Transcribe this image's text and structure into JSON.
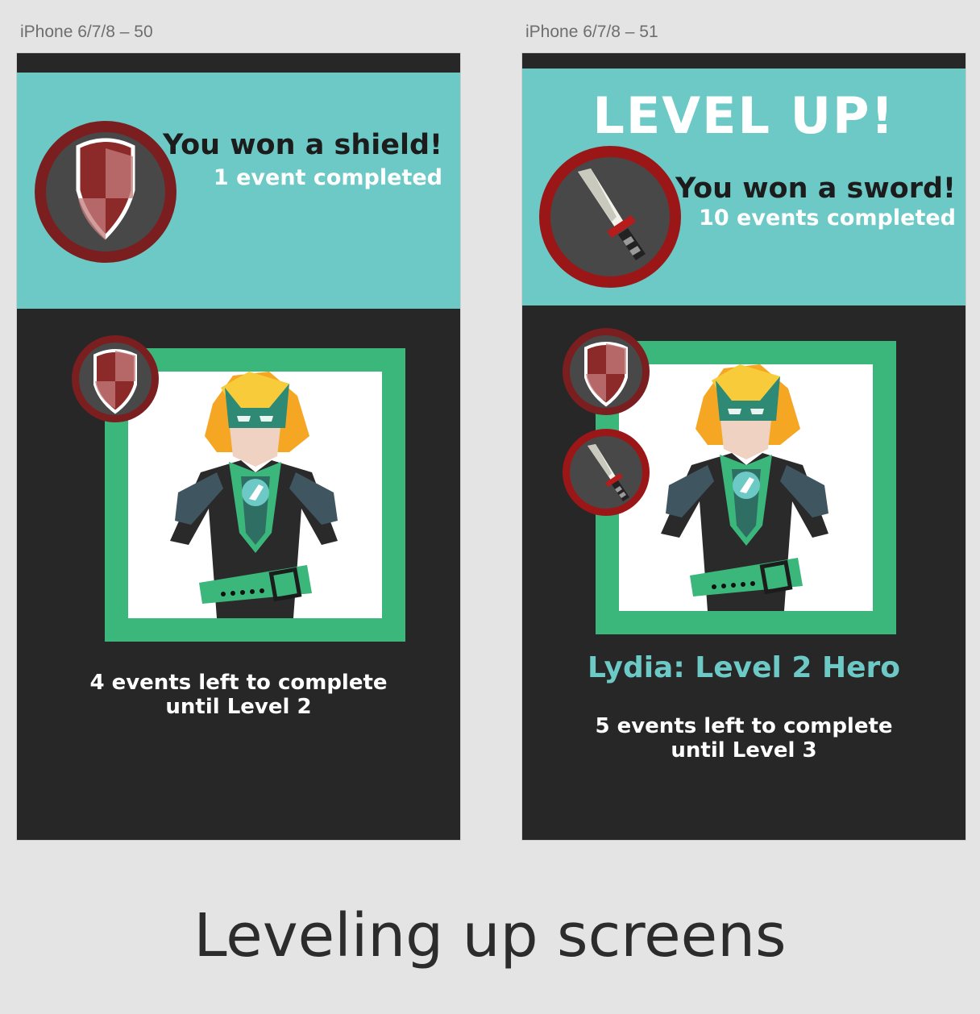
{
  "artboards": [
    {
      "label": "iPhone 6/7/8 – 50",
      "heading": "You won a shield!",
      "subheading": "1 event completed",
      "progress_line1": "4 events left to complete",
      "progress_line2": "until Level 2",
      "award_icon": "shield-icon",
      "inventory": [
        "shield-icon"
      ]
    },
    {
      "label": "iPhone 6/7/8 – 51",
      "banner_title": "LEVEL UP!",
      "heading": "You won a sword!",
      "subheading": "10 events completed",
      "hero_name": "Lydia: Level 2 Hero",
      "progress_line1": "5 events left to complete",
      "progress_line2": "until Level 3",
      "award_icon": "sword-icon",
      "inventory": [
        "shield-icon",
        "sword-icon"
      ]
    }
  ],
  "caption": "Leveling up screens",
  "colors": {
    "canvas": "#e4e4e4",
    "phone_bg": "#272727",
    "banner": "#6cc9c5",
    "frame_green": "#3bb77c",
    "badge_ring_dark": "#7a1e20",
    "badge_ring_red": "#9b1717",
    "badge_fill": "#484848",
    "hero_name": "#6cc9c5"
  }
}
